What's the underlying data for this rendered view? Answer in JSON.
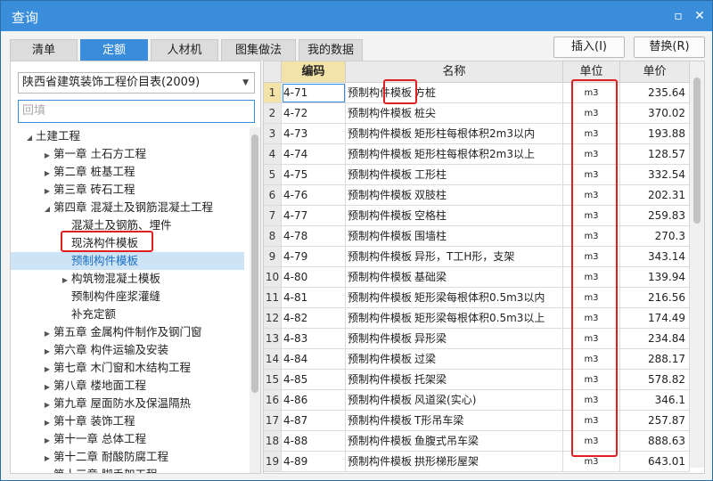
{
  "window": {
    "title": "查询",
    "restore_glyph": "▫",
    "close_glyph": "✕"
  },
  "tabs": [
    {
      "label": "清单",
      "active": false
    },
    {
      "label": "定额",
      "active": true
    },
    {
      "label": "人材机",
      "active": false
    },
    {
      "label": "图集做法",
      "active": false
    },
    {
      "label": "我的数据",
      "active": false
    }
  ],
  "actions": {
    "insert_label": "插入(I)",
    "replace_label": "替换(R)"
  },
  "left": {
    "select_value": "陕西省建筑装饰工程价目表(2009)",
    "search_placeholder": "回填",
    "tree": [
      {
        "label": "土建工程",
        "level": 0,
        "twisty": "open"
      },
      {
        "label": "第一章 土石方工程",
        "level": 1,
        "twisty": "closed"
      },
      {
        "label": "第二章 桩基工程",
        "level": 1,
        "twisty": "closed"
      },
      {
        "label": "第三章 砖石工程",
        "level": 1,
        "twisty": "closed"
      },
      {
        "label": "第四章 混凝土及钢筋混凝土工程",
        "level": 1,
        "twisty": "open"
      },
      {
        "label": "混凝土及钢筋、埋件",
        "level": 2,
        "twisty": "none"
      },
      {
        "label": "现浇构件模板",
        "level": 2,
        "twisty": "none"
      },
      {
        "label": "预制构件模板",
        "level": 2,
        "twisty": "none",
        "selected": true
      },
      {
        "label": "构筑物混凝土模板",
        "level": 2,
        "twisty": "closed"
      },
      {
        "label": "预制构件座浆灌缝",
        "level": 2,
        "twisty": "none"
      },
      {
        "label": "补充定额",
        "level": 2,
        "twisty": "none"
      },
      {
        "label": "第五章 金属构件制作及钢门窗",
        "level": 1,
        "twisty": "closed"
      },
      {
        "label": "第六章 构件运输及安装",
        "level": 1,
        "twisty": "closed"
      },
      {
        "label": "第七章 木门窗和木结构工程",
        "level": 1,
        "twisty": "closed"
      },
      {
        "label": "第八章 楼地面工程",
        "level": 1,
        "twisty": "closed"
      },
      {
        "label": "第九章 屋面防水及保温隔热",
        "level": 1,
        "twisty": "closed"
      },
      {
        "label": "第十章 装饰工程",
        "level": 1,
        "twisty": "closed"
      },
      {
        "label": "第十一章 总体工程",
        "level": 1,
        "twisty": "closed"
      },
      {
        "label": "第十二章 耐酸防腐工程",
        "level": 1,
        "twisty": "closed"
      },
      {
        "label": "第十三章 脚手架工程",
        "level": 1,
        "twisty": "closed"
      }
    ]
  },
  "table": {
    "headers": {
      "code": "编码",
      "name": "名称",
      "unit": "单位",
      "price": "单价"
    },
    "rows": [
      {
        "n": "1",
        "code": "4-71",
        "prefix": "预制构件模板",
        "item": "方桩",
        "unit": "m3",
        "price": "235.64"
      },
      {
        "n": "2",
        "code": "4-72",
        "prefix": "预制构件模板",
        "item": "桩尖",
        "unit": "m3",
        "price": "370.02"
      },
      {
        "n": "3",
        "code": "4-73",
        "prefix": "预制构件模板",
        "item": "矩形柱每根体积2m3以内",
        "unit": "m3",
        "price": "193.88"
      },
      {
        "n": "4",
        "code": "4-74",
        "prefix": "预制构件模板",
        "item": "矩形柱每根体积2m3以上",
        "unit": "m3",
        "price": "128.57"
      },
      {
        "n": "5",
        "code": "4-75",
        "prefix": "预制构件模板",
        "item": "工形柱",
        "unit": "m3",
        "price": "332.54"
      },
      {
        "n": "6",
        "code": "4-76",
        "prefix": "预制构件模板",
        "item": "双肢柱",
        "unit": "m3",
        "price": "202.31"
      },
      {
        "n": "7",
        "code": "4-77",
        "prefix": "预制构件模板",
        "item": "空格柱",
        "unit": "m3",
        "price": "259.83"
      },
      {
        "n": "8",
        "code": "4-78",
        "prefix": "预制构件模板",
        "item": "围墙柱",
        "unit": "m3",
        "price": "270.3"
      },
      {
        "n": "9",
        "code": "4-79",
        "prefix": "预制构件模板",
        "item": "异形，T工H形，支架",
        "unit": "m3",
        "price": "343.14"
      },
      {
        "n": "10",
        "code": "4-80",
        "prefix": "预制构件模板",
        "item": "基础梁",
        "unit": "m3",
        "price": "139.94"
      },
      {
        "n": "11",
        "code": "4-81",
        "prefix": "预制构件模板",
        "item": "矩形梁每根体积0.5m3以内",
        "unit": "m3",
        "price": "216.56"
      },
      {
        "n": "12",
        "code": "4-82",
        "prefix": "预制构件模板",
        "item": "矩形梁每根体积0.5m3以上",
        "unit": "m3",
        "price": "174.49"
      },
      {
        "n": "13",
        "code": "4-83",
        "prefix": "预制构件模板",
        "item": "异形梁",
        "unit": "m3",
        "price": "234.84"
      },
      {
        "n": "14",
        "code": "4-84",
        "prefix": "预制构件模板",
        "item": "过梁",
        "unit": "m3",
        "price": "288.17"
      },
      {
        "n": "15",
        "code": "4-85",
        "prefix": "预制构件模板",
        "item": "托架梁",
        "unit": "m3",
        "price": "578.82"
      },
      {
        "n": "16",
        "code": "4-86",
        "prefix": "预制构件模板",
        "item": "风道梁(实心)",
        "unit": "m3",
        "price": "346.1"
      },
      {
        "n": "17",
        "code": "4-87",
        "prefix": "预制构件模板",
        "item": "T形吊车梁",
        "unit": "m3",
        "price": "257.87"
      },
      {
        "n": "18",
        "code": "4-88",
        "prefix": "预制构件模板",
        "item": "鱼腹式吊车梁",
        "unit": "m3",
        "price": "888.63"
      },
      {
        "n": "19",
        "code": "4-89",
        "prefix": "预制构件模板",
        "item": "拱形梯形屋架",
        "unit": "m3",
        "price": "643.01"
      }
    ]
  }
}
